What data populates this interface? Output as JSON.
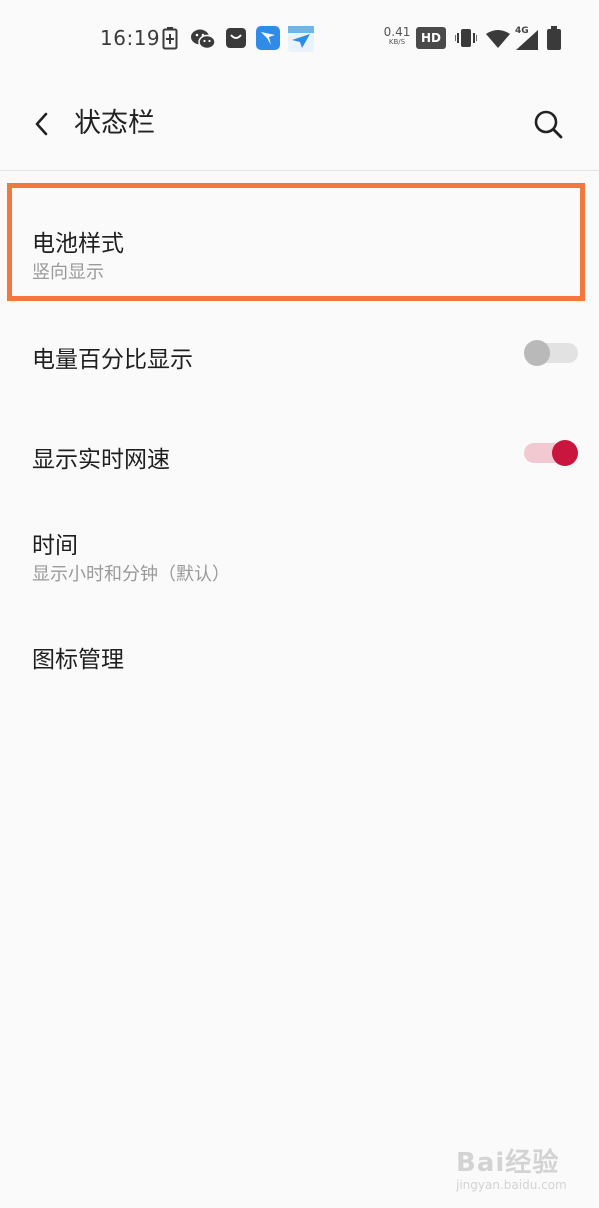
{
  "status_bar": {
    "time": "16:19",
    "net_speed_value": "0.41",
    "net_speed_unit": "KB/S",
    "hd_label": "HD",
    "network_type": "4G",
    "icons": [
      "battery-charging-icon",
      "wechat-icon",
      "bag-icon",
      "app-blue-icon",
      "app-plane-icon",
      "vibrate-icon",
      "wifi-icon",
      "cell-signal-icon",
      "battery-icon"
    ]
  },
  "header": {
    "title": "状态栏",
    "back_icon": "chevron-left-icon",
    "search_icon": "search-icon"
  },
  "settings": [
    {
      "title": "电池样式",
      "subtitle": "竖向显示"
    },
    {
      "title": "电量百分比显示",
      "toggle": false
    },
    {
      "title": "显示实时网速",
      "toggle": true
    },
    {
      "title": "时间",
      "subtitle": "显示小时和分钟（默认）"
    },
    {
      "title": "图标管理"
    }
  ],
  "colors": {
    "highlight": "#f4773f",
    "accent": "#c8163f",
    "background": "#fafafa"
  },
  "watermark": {
    "brand": "Bai经验",
    "url": "jingyan.baidu.com"
  }
}
